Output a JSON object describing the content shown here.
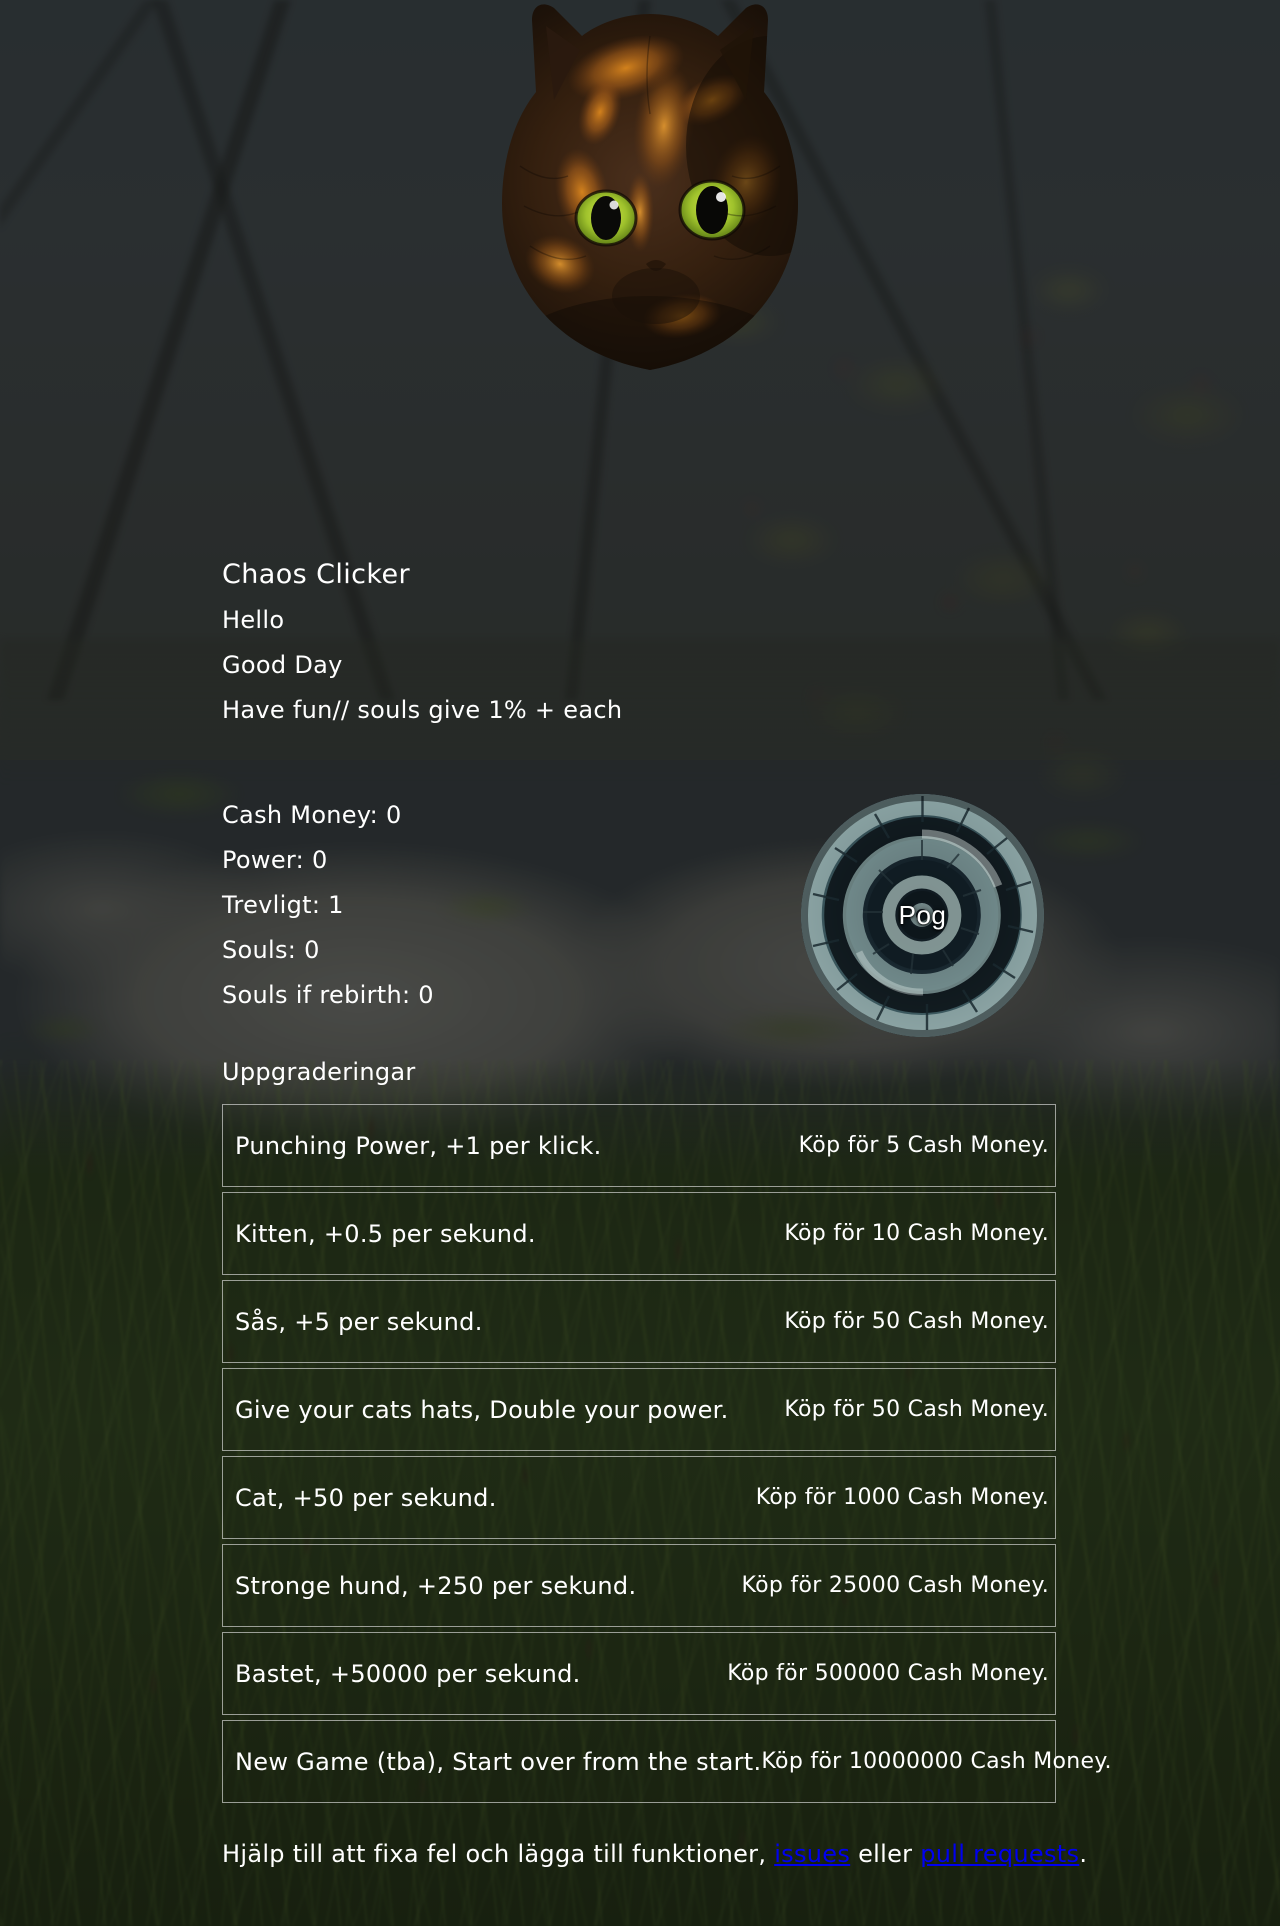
{
  "page": {
    "title": "Chaos Clicker"
  },
  "header": {
    "title": "Chaos Clicker",
    "intro": [
      "Hello",
      "Good Day",
      "Have fun// souls give 1% + each"
    ]
  },
  "stats": [
    {
      "label": "Cash Money:",
      "value": "0"
    },
    {
      "label": "Power:",
      "value": "0"
    },
    {
      "label": "Trevligt:",
      "value": "1"
    },
    {
      "label": "Souls:",
      "value": "0"
    },
    {
      "label": "Souls if rebirth:",
      "value": "0"
    }
  ],
  "stats_lines": [
    "Cash Money: 0",
    "Power: 0",
    "Trevligt: 1",
    "Souls: 0",
    "Souls if rebirth: 0"
  ],
  "clicker": {
    "label": "Pog",
    "icon": "spiral-staircase-image"
  },
  "upgrades": {
    "heading": "Uppgraderingar",
    "items": [
      {
        "name": "Punching Power, +1 per klick.",
        "buy": "Köp för 5 Cash Money.",
        "cost": "5"
      },
      {
        "name": "Kitten, +0.5 per sekund.",
        "buy": "Köp för 10 Cash Money.",
        "cost": "10"
      },
      {
        "name": "Sås, +5 per sekund.",
        "buy": "Köp för 50 Cash Money.",
        "cost": "50"
      },
      {
        "name": "Give your cats hats, Double your power.",
        "buy": "Köp för 50 Cash Money.",
        "cost": "50"
      },
      {
        "name": "Cat, +50 per sekund.",
        "buy": "Köp för 1000 Cash Money.",
        "cost": "1000"
      },
      {
        "name": "Stronge hund, +250 per sekund.",
        "buy": "Köp för 25000 Cash Money.",
        "cost": "25000"
      },
      {
        "name": "Bastet, +50000 per sekund.",
        "buy": "Köp för 500000 Cash Money.",
        "cost": "500000"
      },
      {
        "name": "New Game (tba), Start over from the start.",
        "buy": "Köp för 10000000 Cash Money.",
        "cost": "10000000"
      }
    ]
  },
  "footer": {
    "text_before": "Hjälp till att fixa fel och lägga till funktioner, ",
    "link_issues": "issues",
    "text_middle": " eller ",
    "link_pr": "pull requests",
    "text_after": "."
  },
  "colors": {
    "text": "#ffffff",
    "link": "#0000ee",
    "box_border": "rgba(232,232,232,0.62)",
    "sky": "#454c51",
    "grass": "#31451f"
  }
}
